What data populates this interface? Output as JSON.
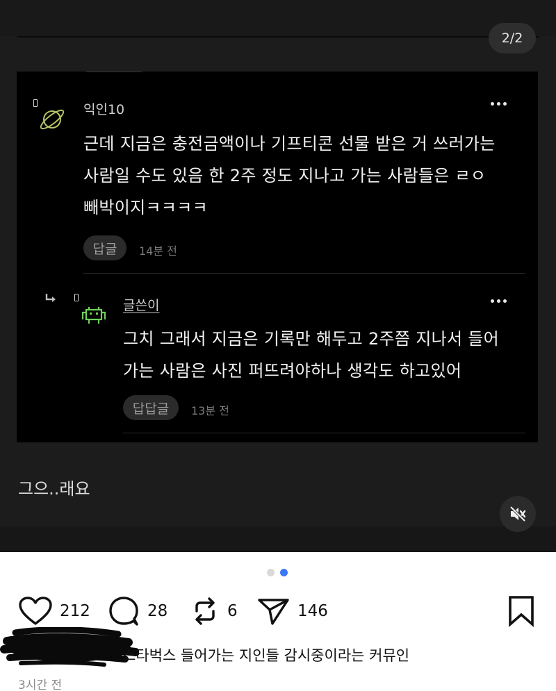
{
  "media": {
    "page_counter": "2/2",
    "comment": {
      "nickname": "익인10",
      "lines": [
        "근데 지금은 충전금액이나 기프티콘 선물 받은 거 쓰러가는",
        "사람일 수도 있음 한 2주 정도 지나고 가는 사람들은 ㄹㅇ",
        "빼박이지ㅋㅋㅋㅋ"
      ],
      "reply_label": "답글",
      "time": "14분 전"
    },
    "reply": {
      "nickname": "글쓴이",
      "lines": [
        "그치 그래서 지금은 기록만 해두고 2주쯤 지나서 들어",
        "가는 사람은 사진 퍼뜨려야하나 생각도 하고있어"
      ],
      "reply_label": "답답글",
      "time": "13분 전"
    },
    "caption": "그으..래요"
  },
  "actions": {
    "likes": "212",
    "comments": "28",
    "reposts": "6",
    "shares": "146"
  },
  "post": {
    "caption": "스타벅스 들어가는 지인들 감시중이라는 커뮤인",
    "time_ago": "3시간 전"
  },
  "colors": {
    "accent_blue": "#3d77f5",
    "planet_icon": "#b7c265",
    "invader_icon": "#6fd15a"
  }
}
